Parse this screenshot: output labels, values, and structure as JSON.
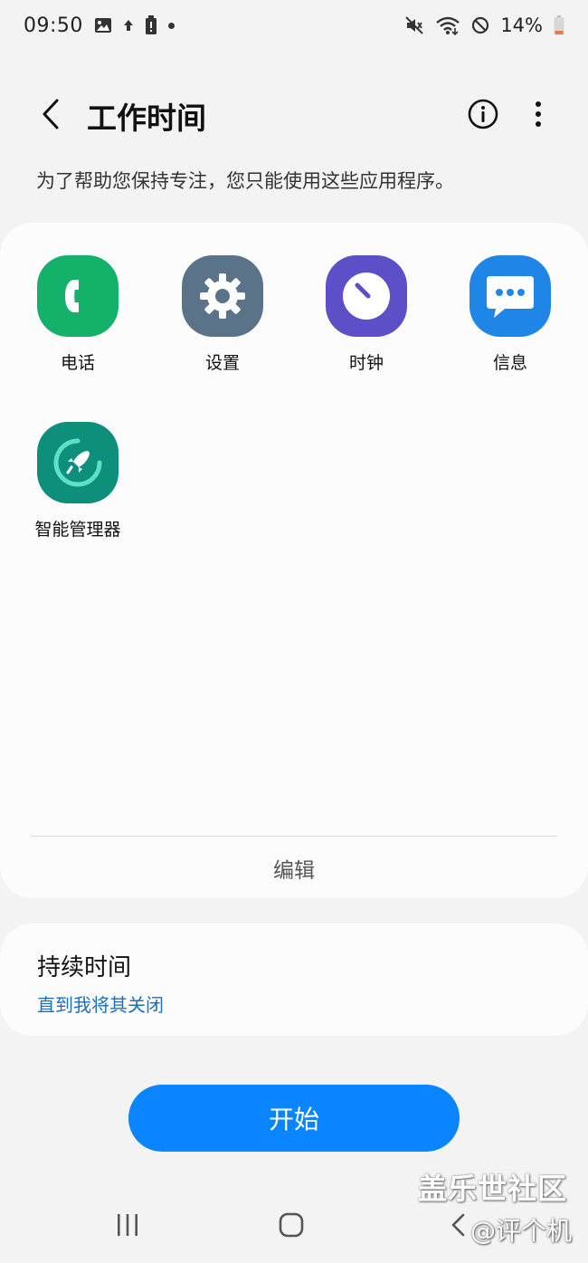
{
  "status_bar": {
    "time": "09:50",
    "battery": "14%",
    "icons": [
      "gallery-icon",
      "upload-arrow-icon",
      "battery-alert-icon",
      "notification-dot-icon",
      "mute-icon",
      "wifi-icon",
      "do-not-disturb-icon",
      "battery-icon"
    ]
  },
  "header": {
    "title": "工作时间",
    "back_icon": "back-arrow-icon",
    "info_icon": "info-icon",
    "more_icon": "more-vertical-icon"
  },
  "subtitle": "为了帮助您保持专注，您只能使用这些应用程序。",
  "apps": [
    {
      "label": "电话",
      "icon": "phone-icon",
      "color": "#14b16a"
    },
    {
      "label": "设置",
      "icon": "gear-icon",
      "color": "#5b7389"
    },
    {
      "label": "时钟",
      "icon": "clock-icon",
      "color": "#5c4fc7"
    },
    {
      "label": "信息",
      "icon": "message-icon",
      "color": "#1f86e8"
    },
    {
      "label": "智能管理器",
      "icon": "rocket-icon",
      "color": "#0d8f7c"
    }
  ],
  "edit_label": "编辑",
  "duration": {
    "title": "持续时间",
    "value": "直到我将其关闭"
  },
  "start_label": "开始",
  "nav": {
    "icons": [
      "recents-icon",
      "home-icon",
      "back-icon"
    ]
  },
  "watermark": {
    "line1": "盖乐世社区",
    "line2": "@评个机"
  },
  "colors": {
    "accent": "#0a84ff",
    "link": "#1c6fbf",
    "background": "#f3f3f3",
    "card": "#fcfcfc"
  }
}
